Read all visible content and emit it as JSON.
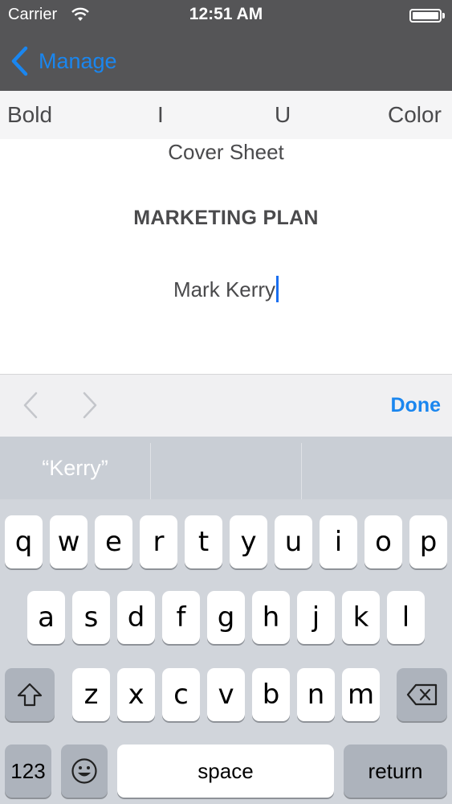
{
  "status_bar": {
    "carrier": "Carrier",
    "time": "12:51 AM"
  },
  "nav": {
    "back_label": "Manage"
  },
  "format_toolbar": {
    "bold": "Bold",
    "italic": "I",
    "underline": "U",
    "color": "Color"
  },
  "document": {
    "line1": "Cover Sheet",
    "line2": "MARKETING PLAN",
    "line3": "Mark Kerry"
  },
  "accessory_bar": {
    "done_label": "Done"
  },
  "keyboard": {
    "predictions": [
      "“Kerry”",
      "",
      ""
    ],
    "row1": [
      "q",
      "w",
      "e",
      "r",
      "t",
      "y",
      "u",
      "i",
      "o",
      "p"
    ],
    "row2": [
      "a",
      "s",
      "d",
      "f",
      "g",
      "h",
      "j",
      "k",
      "l"
    ],
    "row3": [
      "z",
      "x",
      "c",
      "v",
      "b",
      "n",
      "m"
    ],
    "numbers_label": "123",
    "space_label": "space",
    "return_label": "return"
  },
  "colors": {
    "accent": "#1a86ef",
    "nav_bg": "#555557",
    "key_bg": "#ffffff",
    "keyboard_bg": "#d1d5db"
  }
}
